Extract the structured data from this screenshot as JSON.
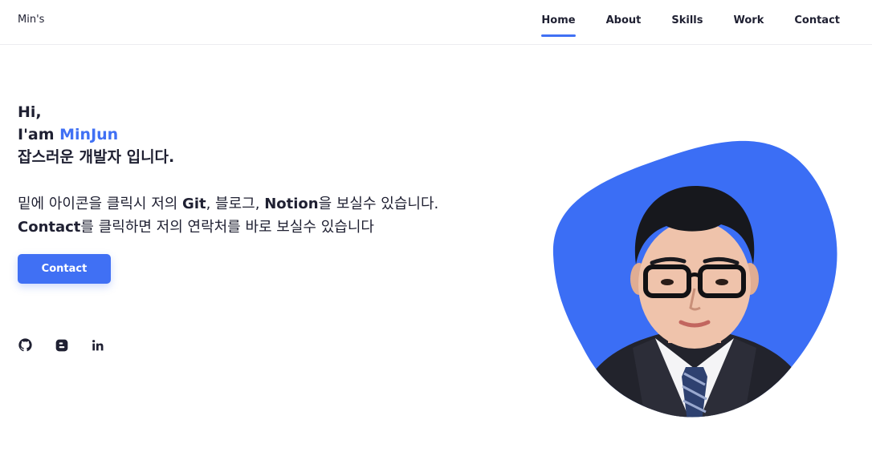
{
  "header": {
    "logo": "Min's",
    "nav": [
      {
        "label": "Home",
        "active": true
      },
      {
        "label": "About",
        "active": false
      },
      {
        "label": "Skills",
        "active": false
      },
      {
        "label": "Work",
        "active": false
      },
      {
        "label": "Contact",
        "active": false
      }
    ]
  },
  "hero": {
    "greeting": "Hi,",
    "iam": "I'am",
    "name": "MinJun",
    "tagline": "잡스러운 개발자 입니다."
  },
  "description": {
    "line1_a": "밑에 아이콘을 클릭시 저의 ",
    "line1_git": "Git",
    "line1_b": ", 블로그, ",
    "line1_notion": "Notion",
    "line1_c": "을 보실수 있습니다.",
    "line2_contact": "Contact",
    "line2_rest": "를 클릭하면 저의 연락처를 바로 보실수 있습니다"
  },
  "contact_button": {
    "label": "Contact"
  },
  "socials": [
    {
      "icon": "github-icon"
    },
    {
      "icon": "blogger-icon"
    },
    {
      "icon": "linkedin-icon"
    }
  ],
  "colors": {
    "accent": "#4070f4",
    "text": "#1f2032",
    "blob": "#3b6ef5"
  }
}
